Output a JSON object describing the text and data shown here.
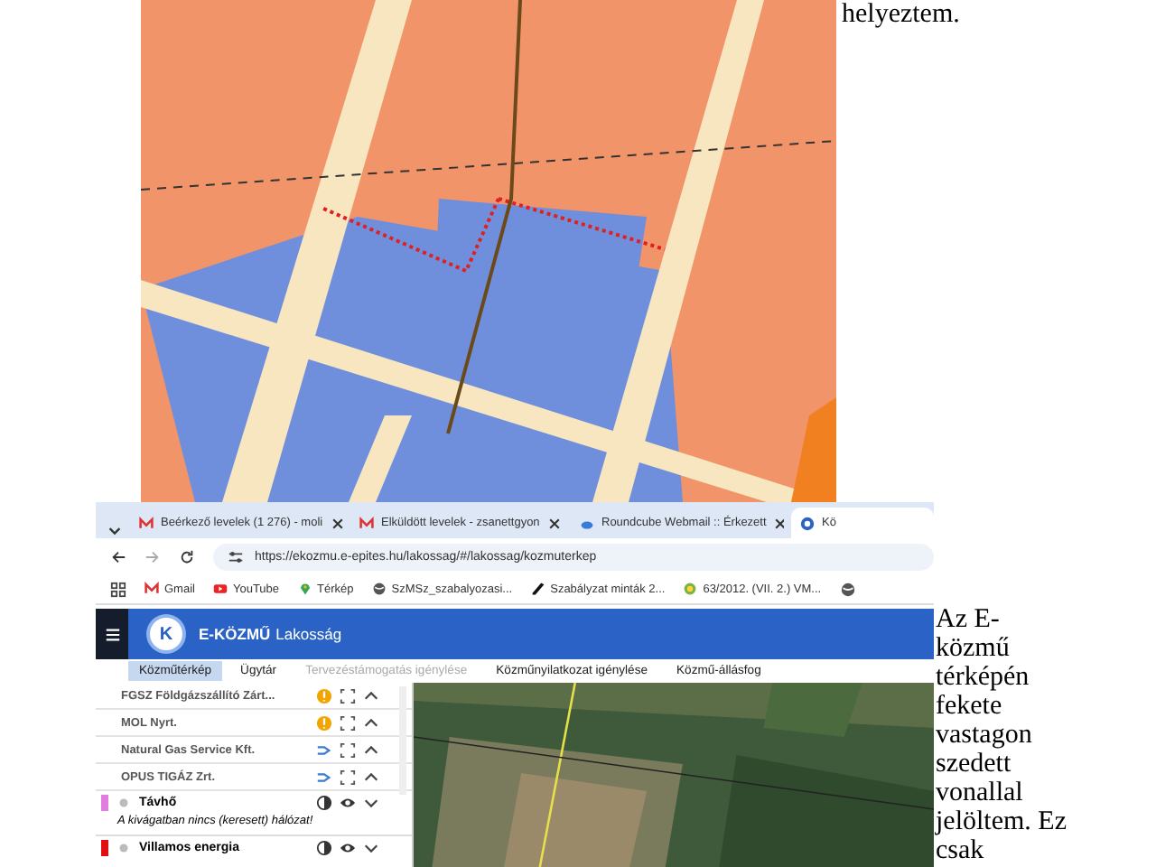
{
  "top_text": "helyeztem.",
  "side_text": "Az E-közmű térképén fekete vastagon szedett vonallal jelöltem. Ez csak",
  "browser": {
    "tabs": [
      {
        "label": "Beérkező levelek (1 276) - moli",
        "kind": "mail",
        "selected": false
      },
      {
        "label": "Elküldött levelek - zsanettgyon",
        "kind": "mail",
        "selected": false
      },
      {
        "label": "Roundcube Webmail :: Érkezett",
        "kind": "cloud",
        "selected": false
      },
      {
        "label": "Kö",
        "kind": "site",
        "selected": true
      }
    ],
    "url": "https://ekozmu.e-epites.hu/lakossag/#/lakossag/kozmuterkep",
    "bookmarks": [
      {
        "label": "Gmail",
        "kind": "mail"
      },
      {
        "label": "YouTube",
        "kind": "video"
      },
      {
        "label": "Térkép",
        "kind": "pin"
      },
      {
        "label": "SzMSz_szabalyozasi...",
        "kind": "globe"
      },
      {
        "label": "Szabályzat minták 2...",
        "kind": "pen"
      },
      {
        "label": "63/2012. (VII. 2.) VM...",
        "kind": "leaf"
      }
    ]
  },
  "app": {
    "logo": "K",
    "brand": "E-KÖZMŰ",
    "section": "Lakosság",
    "nav": [
      {
        "label": "Közműtérkép",
        "selected": true,
        "disabled": false
      },
      {
        "label": "Ügytár",
        "selected": false,
        "disabled": false
      },
      {
        "label": "Tervezéstámogatás igénylése",
        "selected": false,
        "disabled": true
      },
      {
        "label": "Közműnyilatkozat igénylése",
        "selected": false,
        "disabled": false
      },
      {
        "label": "Közmű-állásfog",
        "selected": false,
        "disabled": false
      }
    ],
    "companies": [
      {
        "name": "FGSZ Földgázszállító Zárt...",
        "kind": "alert"
      },
      {
        "name": "MOL Nyrt.",
        "kind": "alert"
      },
      {
        "name": "Natural Gas Service Kft.",
        "kind": "linked"
      },
      {
        "name": "OPUS TIGÁZ Zrt.",
        "kind": "linked"
      }
    ],
    "layers": [
      {
        "name": "Távhő",
        "color": "#e07ee0",
        "message": "A kivágatban nincs (keresett) hálózat!"
      },
      {
        "name": "Villamos energia",
        "color": "#e01010"
      }
    ]
  }
}
